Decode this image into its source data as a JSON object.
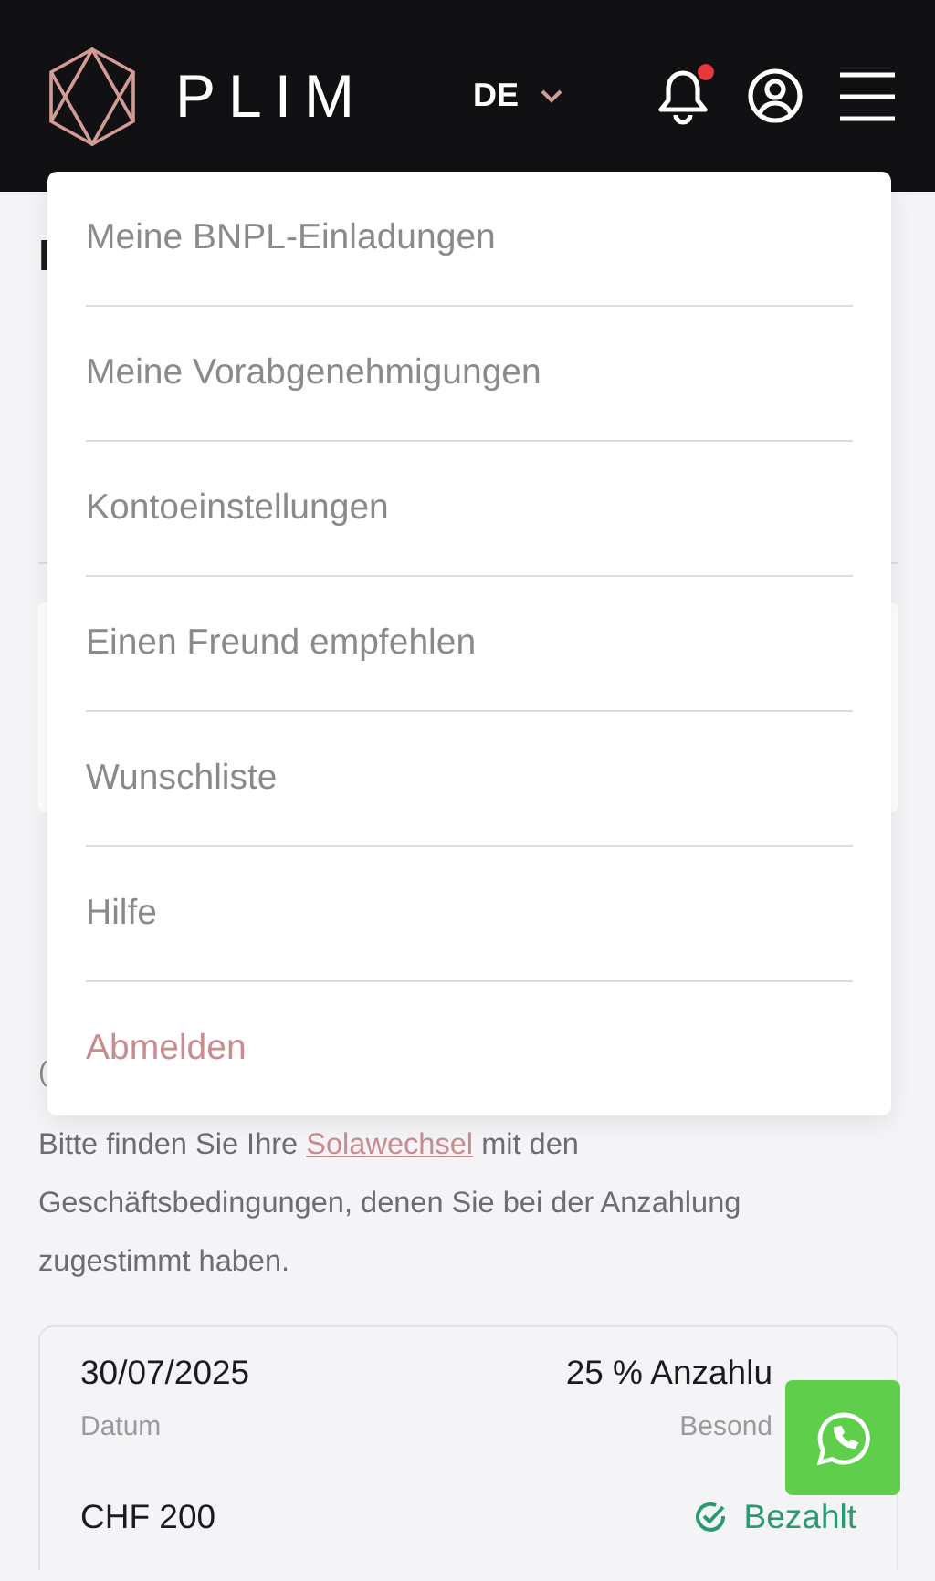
{
  "header": {
    "logo": "PLIM",
    "language": "DE",
    "notifications_unread": true
  },
  "menu": {
    "items": [
      {
        "label": "Meine BNPL-Einladungen",
        "kind": "link"
      },
      {
        "label": "Meine Vorabgenehmigungen",
        "kind": "link"
      },
      {
        "label": "Kontoeinstellungen",
        "kind": "link"
      },
      {
        "label": "Einen Freund empfehlen",
        "kind": "link"
      },
      {
        "label": "Wunschliste",
        "kind": "link"
      },
      {
        "label": "Hilfe",
        "kind": "link"
      },
      {
        "label": "Abmelden",
        "kind": "logout"
      }
    ]
  },
  "background_fragments": [
    {
      "text": "I",
      "kind": "heading"
    },
    {
      "text": "(",
      "kind": "text"
    }
  ],
  "notice": {
    "before": "Bitte finden Sie Ihre",
    "link": "Solawechsel",
    "after": "mit den Geschäftsbedingungen, denen Sie bei der Anzahlung zugestimmt haben."
  },
  "payment": {
    "date": "30/07/2025",
    "date_label": "Datum",
    "type": "25 % Anzahlu",
    "type_label": "Besond",
    "amount": "CHF 200",
    "status": "Bezahlt",
    "paid": true
  }
}
